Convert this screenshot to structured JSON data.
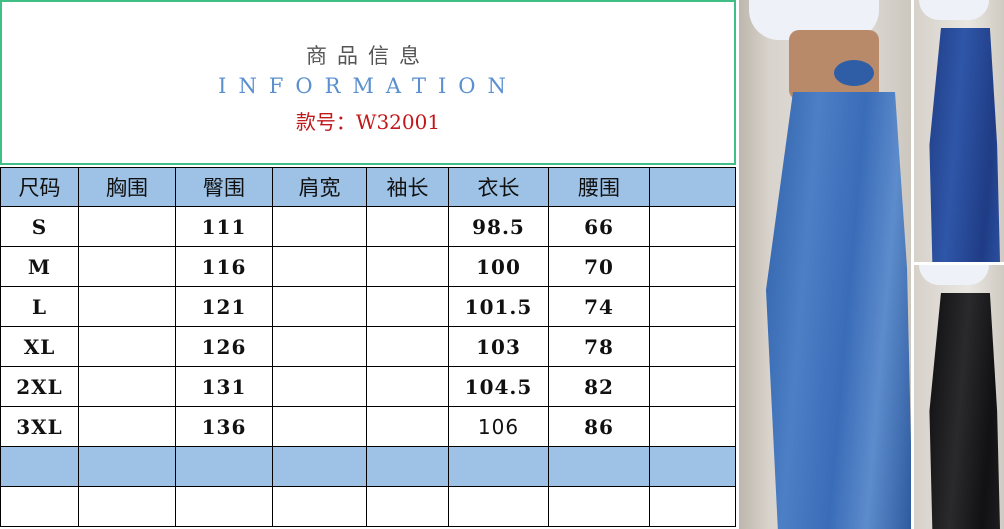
{
  "header": {
    "title_cn": "商品信息",
    "title_en": "INFORMATION",
    "style_no": "款号：W32001"
  },
  "table": {
    "columns": [
      "尺码",
      "胸围",
      "臀围",
      "肩宽",
      "袖长",
      "衣长",
      "腰围",
      ""
    ],
    "rows": [
      [
        "S",
        "",
        "111",
        "",
        "",
        "98.5",
        "66",
        ""
      ],
      [
        "M",
        "",
        "116",
        "",
        "",
        "100",
        "70",
        ""
      ],
      [
        "L",
        "",
        "121",
        "",
        "",
        "101.5",
        "74",
        ""
      ],
      [
        "XL",
        "",
        "126",
        "",
        "",
        "103",
        "78",
        ""
      ],
      [
        "2XL",
        "",
        "131",
        "",
        "",
        "104.5",
        "82",
        ""
      ],
      [
        "3XL",
        "",
        "136",
        "",
        "",
        "106",
        "86",
        ""
      ]
    ]
  },
  "photos": {
    "main_color": "#3a6cb8",
    "top_right_color": "#2f56a8",
    "bottom_right_color": "#1d1d20"
  }
}
